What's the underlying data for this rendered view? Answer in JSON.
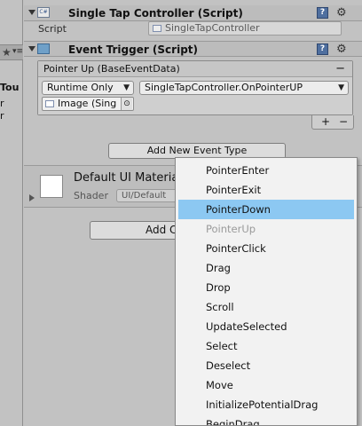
{
  "left_panel": {
    "star": "★",
    "menu_glyph": "▾≡",
    "label_tou": "Tou",
    "label_r1": "r",
    "label_r2": "r"
  },
  "single_tap": {
    "title": "Single Tap Controller (Script)",
    "script_label": "Script",
    "script_value": "SingleTapController"
  },
  "event_trigger": {
    "title": "Event Trigger (Script)",
    "event_header": "Pointer Up (BaseEventData)",
    "runtime": "Runtime Only",
    "function": "SingleTapController.OnPointerUP",
    "object": "Image (Sing",
    "plus": "+",
    "minus": "−",
    "remove": "−"
  },
  "add_event_button": "Add New Event Type",
  "material": {
    "name": "Default UI Materia",
    "shader_label": "Shader",
    "shader_value": "UI/Default"
  },
  "add_component_button": "Add C",
  "popup_items": [
    {
      "label": "PointerEnter",
      "state": "normal"
    },
    {
      "label": "PointerExit",
      "state": "normal"
    },
    {
      "label": "PointerDown",
      "state": "selected"
    },
    {
      "label": "PointerUp",
      "state": "disabled"
    },
    {
      "label": "PointerClick",
      "state": "normal"
    },
    {
      "label": "Drag",
      "state": "normal"
    },
    {
      "label": "Drop",
      "state": "normal"
    },
    {
      "label": "Scroll",
      "state": "normal"
    },
    {
      "label": "UpdateSelected",
      "state": "normal"
    },
    {
      "label": "Select",
      "state": "normal"
    },
    {
      "label": "Deselect",
      "state": "normal"
    },
    {
      "label": "Move",
      "state": "normal"
    },
    {
      "label": "InitializePotentialDrag",
      "state": "normal"
    },
    {
      "label": "BeginDrag",
      "state": "normal"
    }
  ],
  "colors": {
    "selected_highlight": "#8cc8f2",
    "inspector_bg": "#c2c2c2"
  },
  "icons": {
    "help": "?",
    "gear": "⚙",
    "target": "⊙"
  }
}
